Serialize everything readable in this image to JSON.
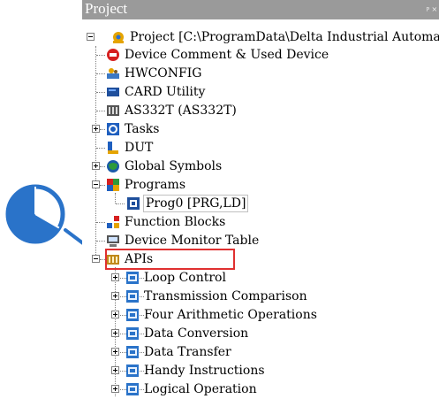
{
  "panel": {
    "title": "Project",
    "pin_glyph": "ᵖ ×"
  },
  "tree": {
    "root": "Project [C:\\ProgramData\\Delta Industrial Automatio",
    "device_comment": "Device Comment & Used Device",
    "hwconfig": "HWCONFIG",
    "card_utility": "CARD Utility",
    "as332t": "AS332T  (AS332T)",
    "tasks": "Tasks",
    "dut": "DUT",
    "global_symbols": "Global Symbols",
    "programs": "Programs",
    "prog0": "Prog0 [PRG,LD]",
    "function_blocks": "Function Blocks",
    "device_monitor": "Device Monitor Table",
    "apis": "APIs",
    "api_items": [
      "Loop Control",
      "Transmission Comparison",
      "Four Arithmetic Operations",
      "Data Conversion",
      "Data Transfer",
      "Handy Instructions",
      "Logical Operation"
    ]
  },
  "colors": {
    "highlight": "#e03030",
    "arrow": "#2a73c9",
    "titlebar": "#9a9a9a"
  },
  "icons": [
    "project-icon",
    "device-comment-icon",
    "hwconfig-icon",
    "card-utility-icon",
    "plc-icon",
    "tasks-icon",
    "dut-icon",
    "global-symbols-icon",
    "programs-icon",
    "program-icon",
    "function-blocks-icon",
    "device-monitor-icon",
    "apis-icon",
    "api-item-icon"
  ]
}
